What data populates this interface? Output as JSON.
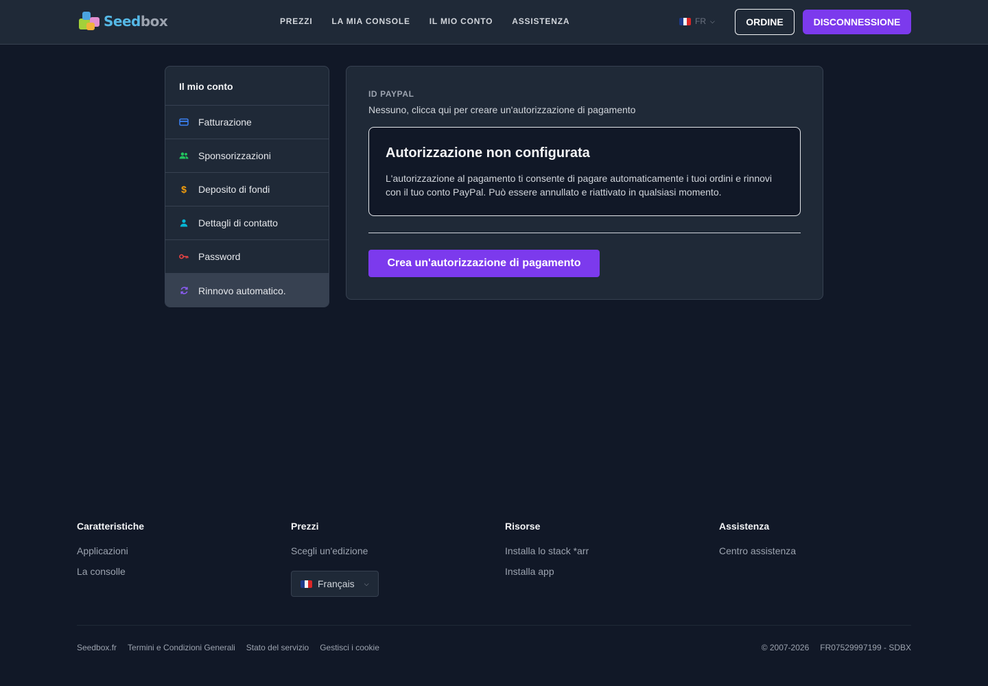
{
  "header": {
    "logo_text_a": "Seed",
    "logo_text_b": "box",
    "nav": [
      "PREZZI",
      "LA MIA CONSOLE",
      "IL MIO CONTO",
      "ASSISTENZA"
    ],
    "lang_code": "FR",
    "order_label": "ORDINE",
    "logout_label": "DISCONNESSIONE"
  },
  "sidebar": {
    "title": "Il mio conto",
    "items": [
      {
        "label": "Fatturazione",
        "icon": "credit-card-icon",
        "color": "#3b82f6"
      },
      {
        "label": "Sponsorizzazioni",
        "icon": "users-icon",
        "color": "#22c55e"
      },
      {
        "label": "Deposito di fondi",
        "icon": "dollar-icon",
        "color": "#f59e0b"
      },
      {
        "label": "Dettagli di contatto",
        "icon": "user-icon",
        "color": "#06b6d4"
      },
      {
        "label": "Password",
        "icon": "key-icon",
        "color": "#ef4444"
      },
      {
        "label": "Rinnovo automatico.",
        "icon": "refresh-icon",
        "color": "#8b5cf6",
        "active": true
      }
    ]
  },
  "main": {
    "paypal_label": "ID PAYPAL",
    "paypal_value": "Nessuno, clicca qui per creare un'autorizzazione di pagamento",
    "notice_title": "Autorizzazione non configurata",
    "notice_body": "L'autorizzazione al pagamento ti consente di pagare automaticamente i tuoi ordini e rinnovi con il tuo conto PayPal. Può essere annullato e riattivato in qualsiasi momento.",
    "create_button": "Crea un'autorizzazione di pagamento"
  },
  "footer": {
    "columns": [
      {
        "title": "Caratteristiche",
        "links": [
          "Applicazioni",
          "La consolle"
        ]
      },
      {
        "title": "Prezzi",
        "links": [
          "Scegli un'edizione"
        ]
      },
      {
        "title": "Risorse",
        "links": [
          "Installa lo stack *arr",
          "Installa app"
        ]
      },
      {
        "title": "Assistenza",
        "links": [
          "Centro assistenza"
        ]
      }
    ],
    "language_select": "Français",
    "bottom_links": [
      "Seedbox.fr",
      "Termini e Condizioni Generali",
      "Stato del servizio",
      "Gestisci i cookie"
    ],
    "copyright": "© 2007-2026",
    "company_id": "FR07529997199 - SDBX"
  },
  "colors": {
    "accent": "#7c3aed",
    "background": "#111827",
    "surface": "#1f2937"
  }
}
